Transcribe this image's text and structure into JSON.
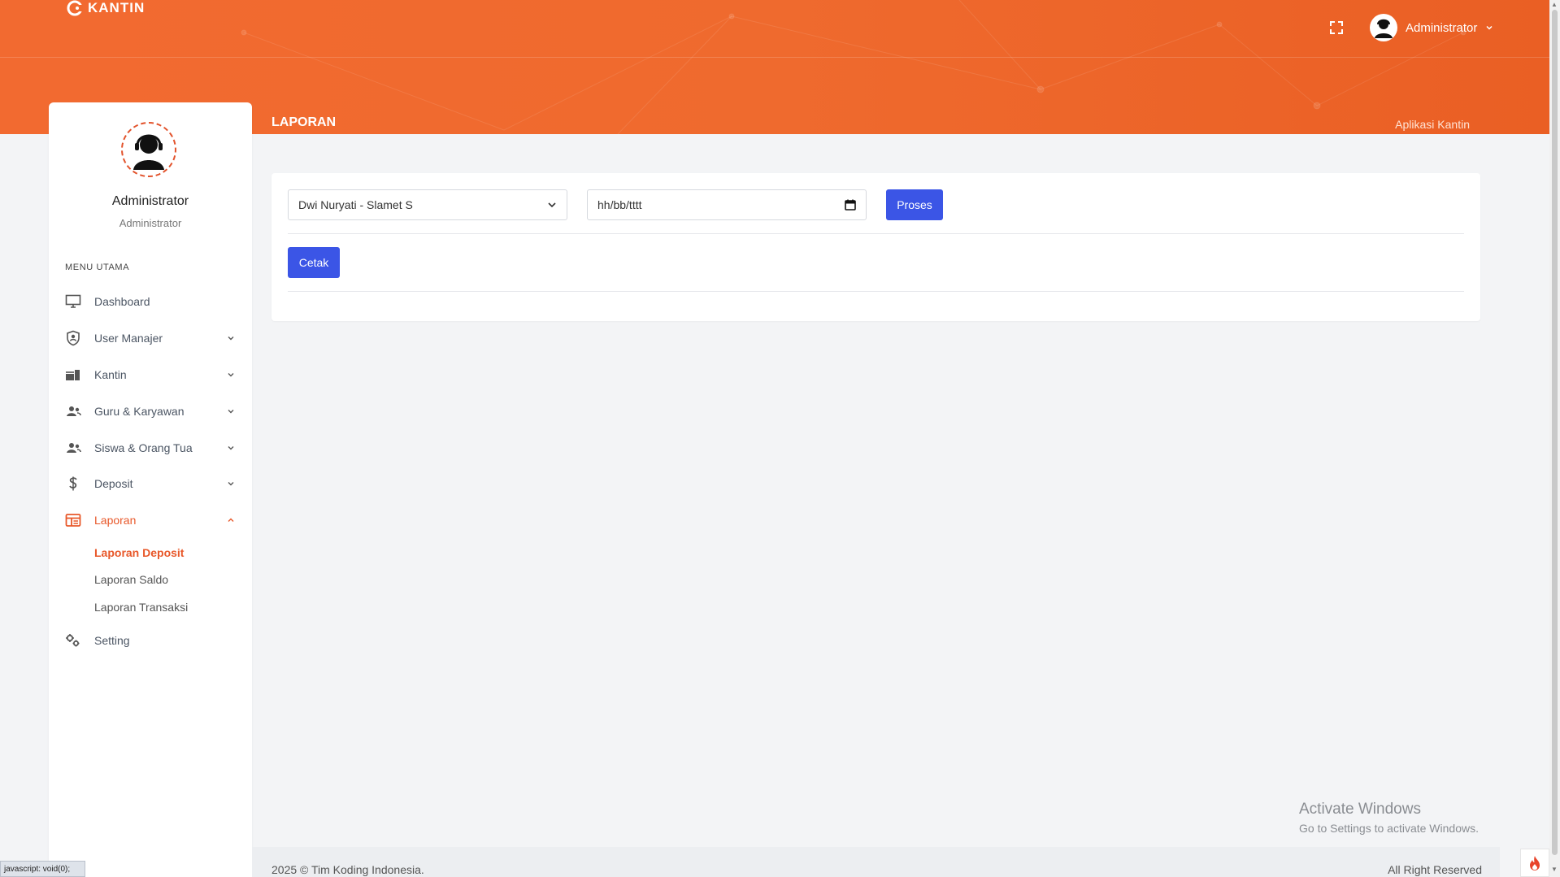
{
  "header": {
    "brand": "KANTIN",
    "user_name": "Administrator",
    "page_title": "LAPORAN",
    "app_name": "Aplikasi Kantin"
  },
  "sidebar": {
    "profile_name": "Administrator",
    "profile_role": "Administrator",
    "menu_heading": "MENU UTAMA",
    "items": [
      {
        "label": "Dashboard",
        "icon": "monitor-icon"
      },
      {
        "label": "User Manajer",
        "icon": "shield-user-icon"
      },
      {
        "label": "Kantin",
        "icon": "store-icon"
      },
      {
        "label": "Guru & Karyawan",
        "icon": "users-icon"
      },
      {
        "label": "Siswa & Orang Tua",
        "icon": "users-icon"
      },
      {
        "label": "Deposit",
        "icon": "dollar-icon"
      },
      {
        "label": "Laporan",
        "icon": "report-icon"
      },
      {
        "label": "Setting",
        "icon": "gears-icon"
      }
    ],
    "sub_items": [
      "Laporan Deposit",
      "Laporan Saldo",
      "Laporan Transaksi"
    ]
  },
  "form": {
    "select_value": "Dwi Nuryati - Slamet S",
    "date_placeholder": "hh/bb/tttt",
    "proses_label": "Proses",
    "cetak_label": "Cetak"
  },
  "footer": {
    "left": "2025 © Tim Koding Indonesia.",
    "right": "All Right Reserved"
  },
  "watermark": {
    "line1": "Activate Windows",
    "line2": "Go to Settings to activate Windows."
  },
  "statusbar": "javascript: void(0);",
  "colors": {
    "header": "#ef6a2e",
    "accent": "#e8582a",
    "button": "#3b55e6"
  }
}
